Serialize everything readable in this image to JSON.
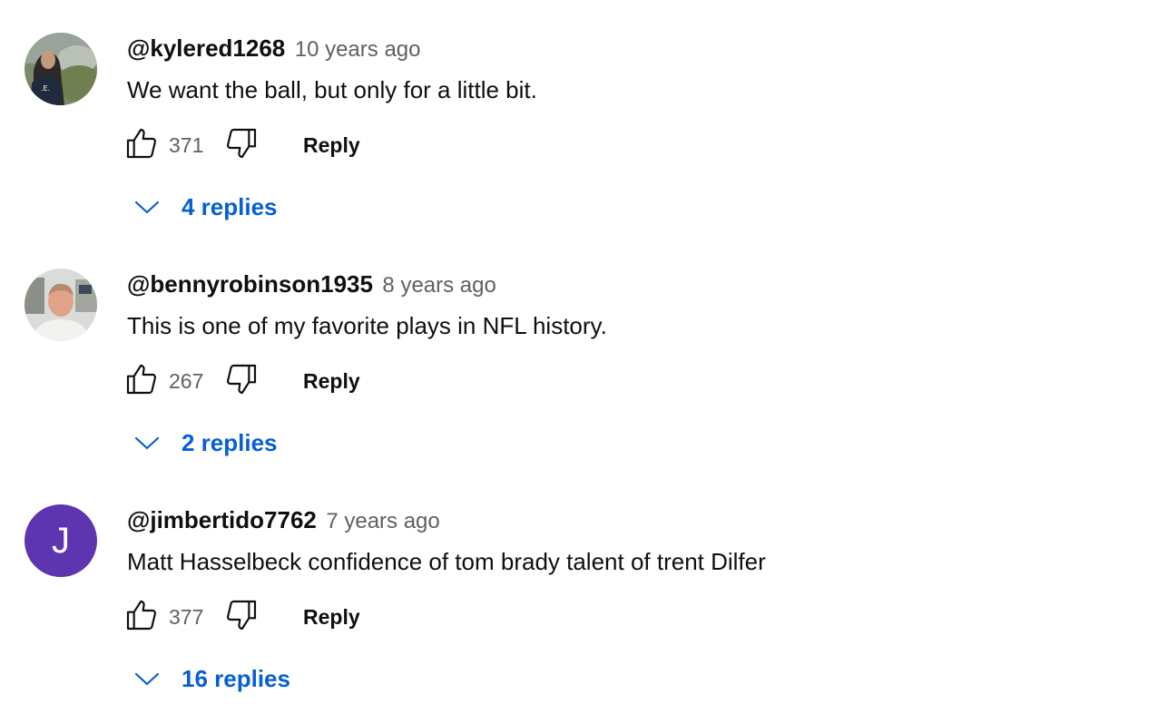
{
  "comments": [
    {
      "author": "@kylered1268",
      "time": "10 years ago",
      "text": "We want the ball, but only for a little bit.",
      "likes": "371",
      "reply_label": "Reply",
      "replies_label": "4 replies",
      "avatar": {
        "type": "photo",
        "icon": "user-photo-avatar"
      }
    },
    {
      "author": "@bennyrobinson1935",
      "time": "8 years ago",
      "text": "This is one of my favorite plays in NFL history.",
      "likes": "267",
      "reply_label": "Reply",
      "replies_label": "2 replies",
      "avatar": {
        "type": "photo",
        "icon": "user-photo-avatar"
      }
    },
    {
      "author": "@jimbertido7762",
      "time": "7 years ago",
      "text": "Matt Hasselbeck confidence of tom brady talent of trent Dilfer",
      "likes": "377",
      "reply_label": "Reply",
      "replies_label": "16 replies",
      "avatar": {
        "type": "letter",
        "letter": "J",
        "color": "#5e35b1"
      }
    }
  ],
  "colors": {
    "text": "#0f0f0f",
    "secondary_text": "#606060",
    "link_blue": "#065fd4"
  },
  "icons": {
    "like": "thumbs-up-icon",
    "dislike": "thumbs-down-icon",
    "expand": "chevron-down-icon"
  }
}
